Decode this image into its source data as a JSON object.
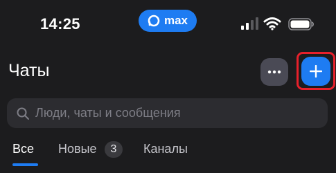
{
  "status_bar": {
    "time": "14:25",
    "app_pill_label": "max",
    "signal_icon": "cellular-signal-icon",
    "wifi_icon": "wifi-icon",
    "battery_icon": "battery-icon"
  },
  "header": {
    "title": "Чаты",
    "more_icon": "more-horizontal-icon",
    "add_icon": "plus-icon"
  },
  "search": {
    "placeholder": "Люди, чаты и сообщения",
    "value": ""
  },
  "tabs": [
    {
      "label": "Все",
      "active": true
    },
    {
      "label": "Новые",
      "badge": "3",
      "active": false
    },
    {
      "label": "Каналы",
      "active": false
    }
  ],
  "colors": {
    "accent": "#1e7cf2",
    "background": "#1c1c1e",
    "highlight": "#e8202b"
  }
}
